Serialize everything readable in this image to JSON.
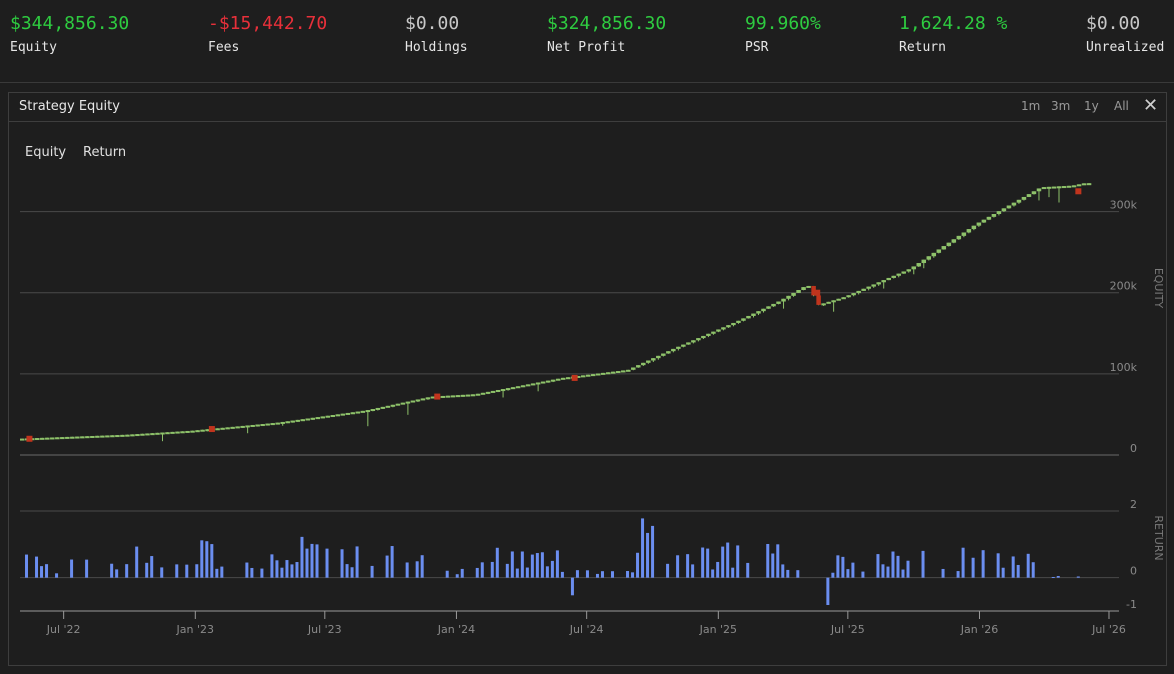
{
  "stats": [
    {
      "value": "$344,856.30",
      "label": "Equity",
      "color": "#2ecc40"
    },
    {
      "value": "-$15,442.70",
      "label": "Fees",
      "color": "#e8303a"
    },
    {
      "value": "$0.00",
      "label": "Holdings",
      "color": "#c8c8c8"
    },
    {
      "value": "$324,856.30",
      "label": "Net Profit",
      "color": "#2ecc40"
    },
    {
      "value": "99.960%",
      "label": "PSR",
      "color": "#2ecc40"
    },
    {
      "value": "1,624.28 %",
      "label": "Return",
      "color": "#2ecc40"
    },
    {
      "value": "$0.00",
      "label": "Unrealized",
      "color": "#c8c8c8"
    }
  ],
  "panel": {
    "title": "Strategy Equity",
    "ranges": [
      "1m",
      "3m",
      "1y",
      "All"
    ],
    "close_icon": "close-icon"
  },
  "legend": [
    "Equity",
    "Return"
  ],
  "colors": {
    "up": "#8ec26a",
    "down": "#c0341d",
    "bar": "#6b8ef0"
  },
  "chart_data": [
    {
      "type": "candlestick",
      "title": "Strategy Equity",
      "ylabel": "EQUITY",
      "yticks": [
        "0",
        "100k",
        "200k",
        "300k"
      ],
      "ylim": [
        0,
        350000
      ],
      "x_start": "2022-05-01",
      "x_end": "2026-07-15",
      "xticks": [
        "Jul '22",
        "Jan '23",
        "Jul '23",
        "Jan '24",
        "Jul '24",
        "Jan '25",
        "Jul '25",
        "Jan '26",
        "Jul '26"
      ],
      "key_points": [
        {
          "date": "2022-05-01",
          "value": 20000
        },
        {
          "date": "2022-10-01",
          "value": 25000
        },
        {
          "date": "2023-01-01",
          "value": 30000
        },
        {
          "date": "2023-05-01",
          "value": 40000
        },
        {
          "date": "2023-09-01",
          "value": 55000
        },
        {
          "date": "2023-12-01",
          "value": 72000
        },
        {
          "date": "2024-02-01",
          "value": 75000
        },
        {
          "date": "2024-06-01",
          "value": 95000
        },
        {
          "date": "2024-09-01",
          "value": 105000
        },
        {
          "date": "2024-11-01",
          "value": 130000
        },
        {
          "date": "2025-02-01",
          "value": 165000
        },
        {
          "date": "2025-04-01",
          "value": 190000
        },
        {
          "date": "2025-05-10",
          "value": 210000
        },
        {
          "date": "2025-05-25",
          "value": 185000
        },
        {
          "date": "2025-07-01",
          "value": 195000
        },
        {
          "date": "2025-10-01",
          "value": 230000
        },
        {
          "date": "2026-01-01",
          "value": 285000
        },
        {
          "date": "2026-04-01",
          "value": 330000
        },
        {
          "date": "2026-05-15",
          "value": 332000
        },
        {
          "date": "2026-06-01",
          "value": 335000
        }
      ],
      "down_periods": [
        {
          "date": "2022-05-10",
          "value": 20000
        },
        {
          "date": "2023-01-20",
          "value": 32000
        },
        {
          "date": "2023-12-01",
          "value": 72000
        },
        {
          "date": "2024-06-10",
          "value": 95000
        },
        {
          "date": "2025-05-15",
          "value": 200000
        },
        {
          "date": "2026-05-15",
          "value": 325000
        }
      ]
    },
    {
      "type": "bar",
      "ylabel": "RETURN",
      "yticks": [
        "-1",
        "0",
        "2"
      ],
      "ylim": [
        -1,
        2
      ]
    }
  ]
}
